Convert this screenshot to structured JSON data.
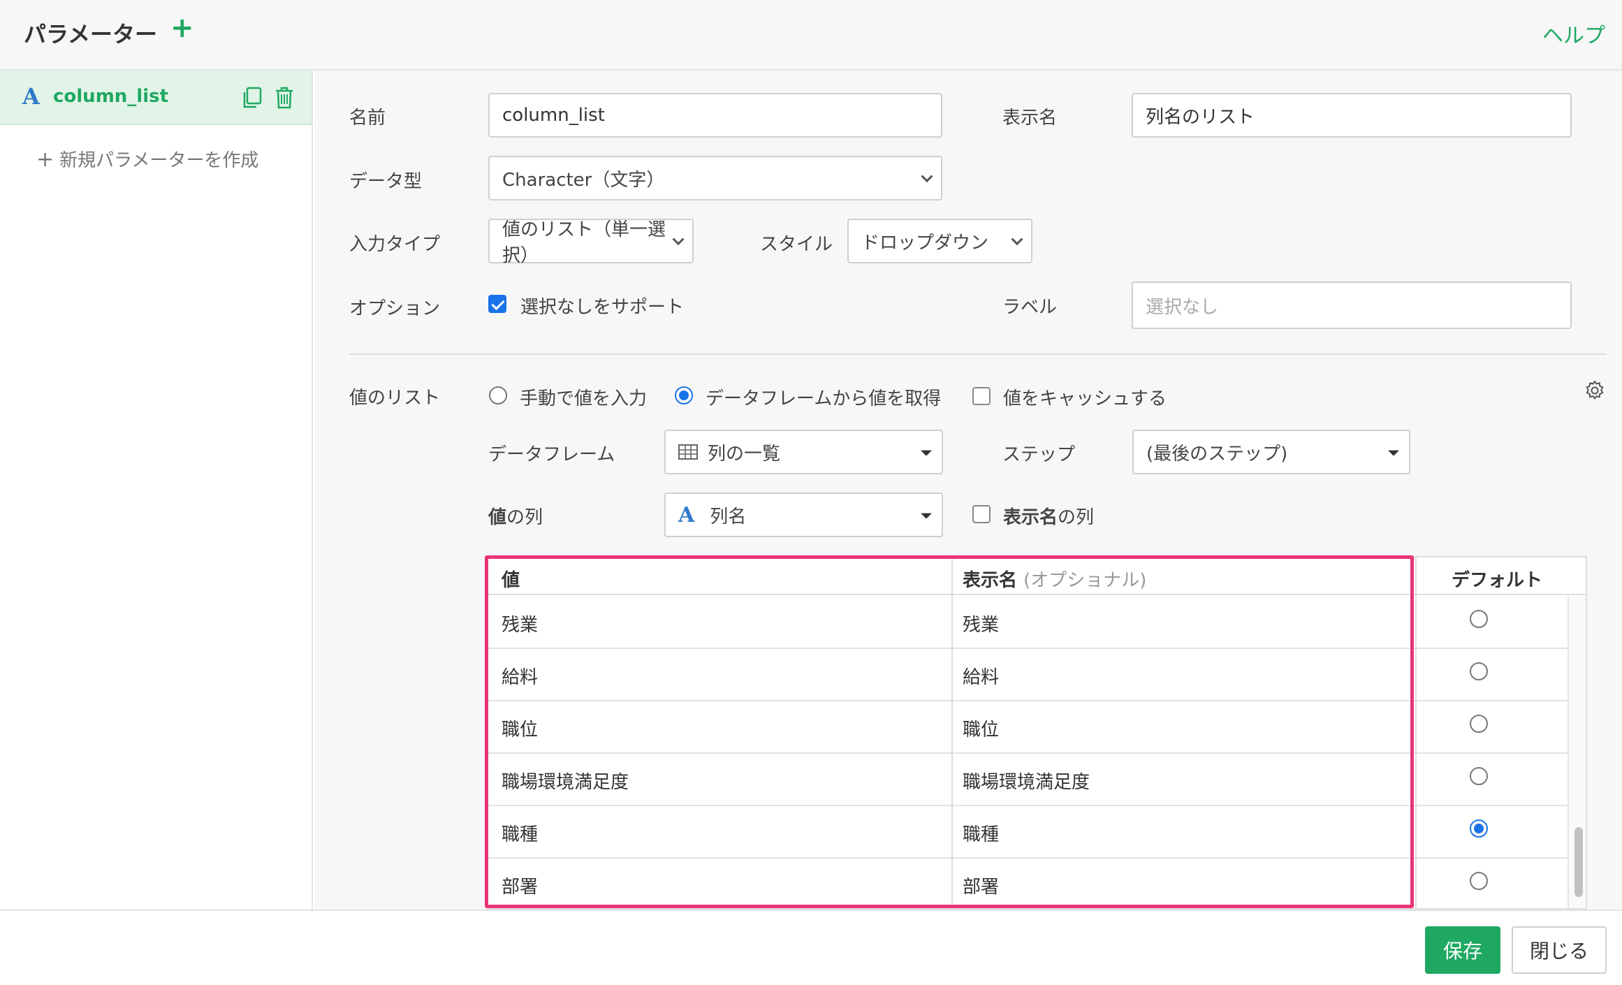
{
  "header": {
    "title": "パラメーター",
    "add_icon": "+",
    "help": "ヘルプ"
  },
  "sidebar": {
    "items": [
      {
        "type_icon": "A",
        "name": "column_list"
      }
    ],
    "new_label": "新規パラメーターを作成"
  },
  "form": {
    "name_label": "名前",
    "name_value": "column_list",
    "display_name_label": "表示名",
    "display_name_value": "列名のリスト",
    "data_type_label": "データ型",
    "data_type_value": "Character（文字）",
    "input_type_label": "入力タイプ",
    "input_type_value": "値のリスト（単一選択）",
    "style_label": "スタイル",
    "style_value": "ドロップダウン",
    "option_label": "オプション",
    "support_none_label": "選択なしをサポート",
    "support_none_checked": true,
    "label_label": "ラベル",
    "label_placeholder": "選択なし"
  },
  "value_list": {
    "section_label": "値のリスト",
    "source_manual": "手動で値を入力",
    "source_dataframe": "データフレームから値を取得",
    "source_selected": "dataframe",
    "cache_label": "値をキャッシュする",
    "cache_checked": false,
    "dataframe_label": "データフレーム",
    "dataframe_value": "列の一覧",
    "step_label": "ステップ",
    "step_value": "(最後のステップ)",
    "value_column_label_bold": "値",
    "value_column_label_rest": "の列",
    "value_column_type_icon": "A",
    "value_column_value": "列名",
    "display_col_label_bold": "表示名",
    "display_col_label_rest": "の列",
    "display_col_checked": false
  },
  "table": {
    "headers": {
      "value": "値",
      "display": "表示名",
      "display_optional": "(オプショナル)",
      "default": "デフォルト"
    },
    "rows": [
      {
        "value": "残業",
        "display": "残業"
      },
      {
        "value": "給料",
        "display": "給料"
      },
      {
        "value": "職位",
        "display": "職位"
      },
      {
        "value": "職場環境満足度",
        "display": "職場環境満足度"
      },
      {
        "value": "職種",
        "display": "職種"
      },
      {
        "value": "部署",
        "display": "部署"
      }
    ],
    "default_row": "職種"
  },
  "footer": {
    "save": "保存",
    "close": "閉じる"
  },
  "colors": {
    "accent": "#1fa862",
    "highlight": "#ea3477",
    "radio": "#1a73e8"
  }
}
